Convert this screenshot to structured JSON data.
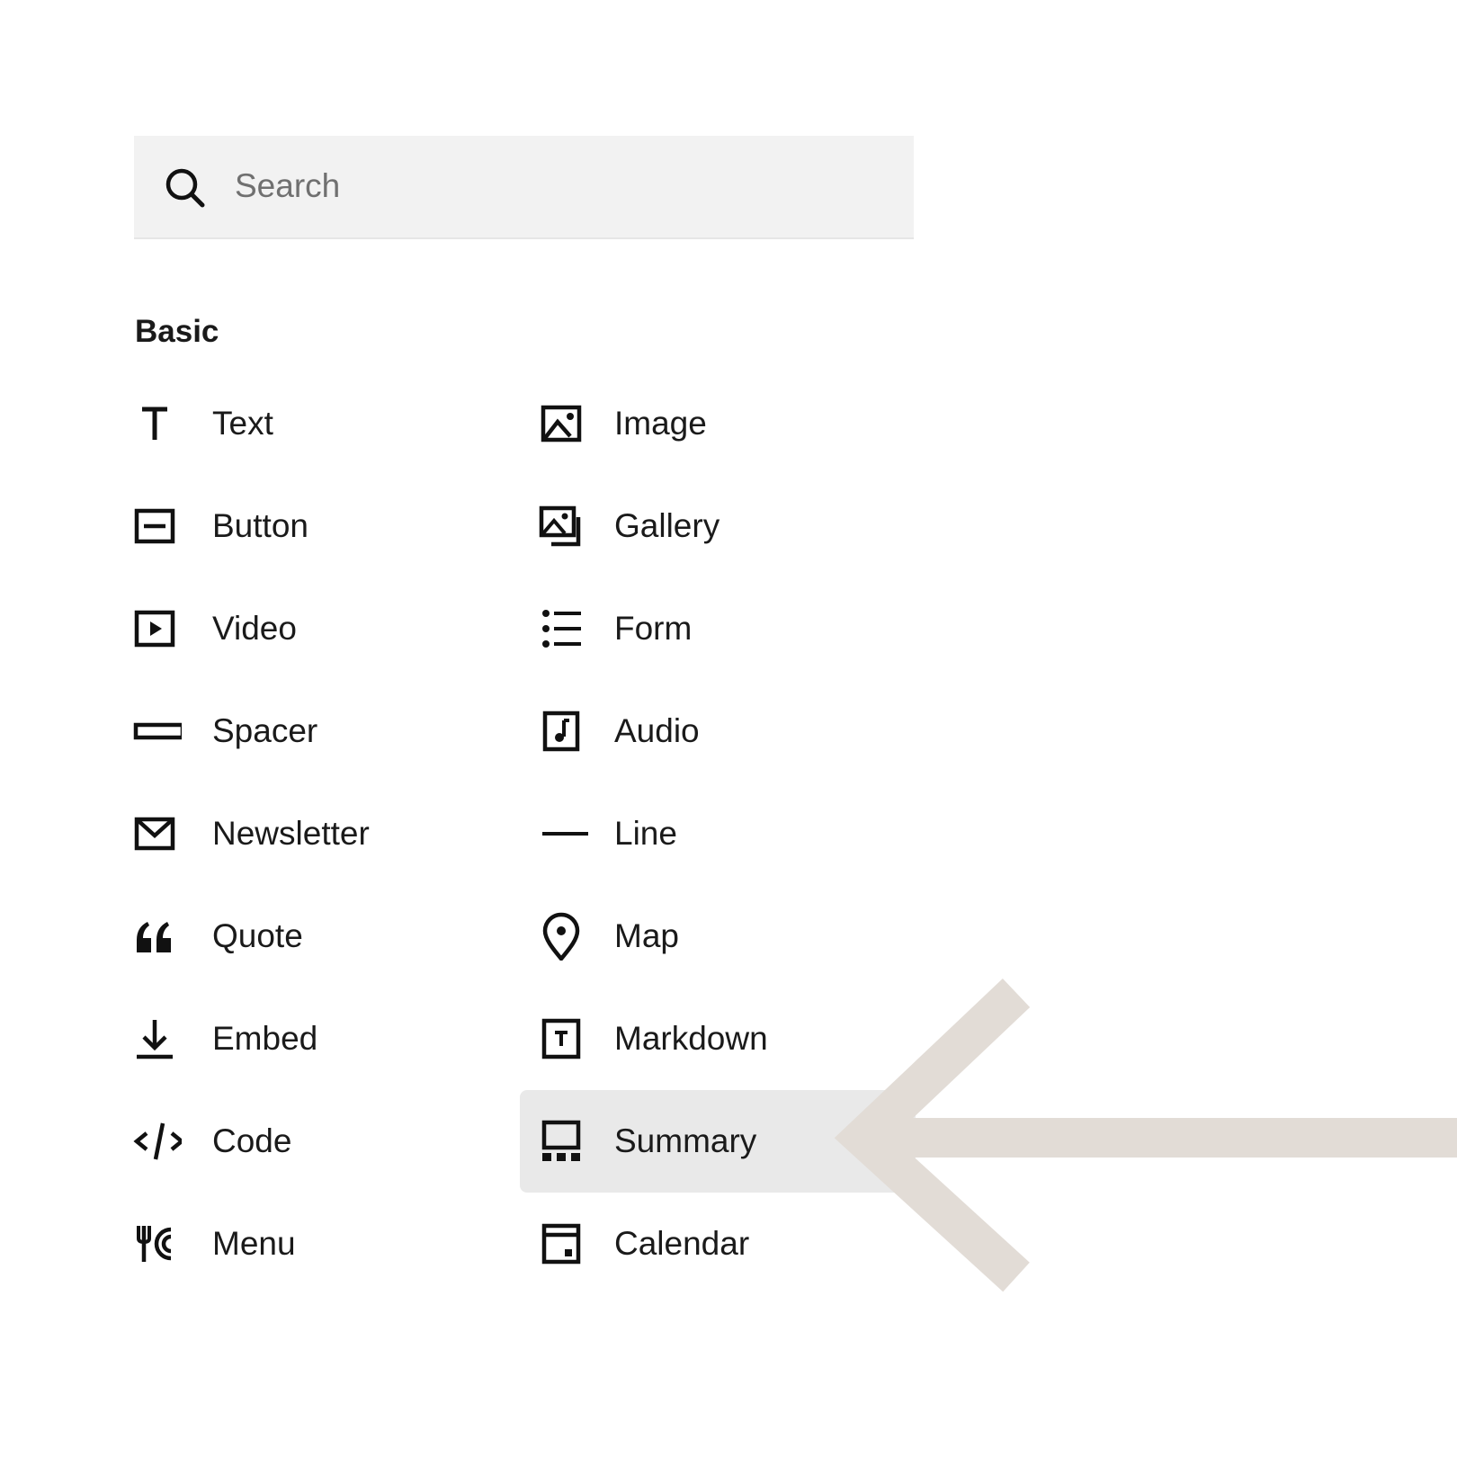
{
  "search": {
    "placeholder": "Search",
    "icon": "search-icon"
  },
  "section": {
    "title": "Basic"
  },
  "blocks": {
    "left": [
      {
        "label": "Text",
        "icon": "text-icon"
      },
      {
        "label": "Button",
        "icon": "button-icon"
      },
      {
        "label": "Video",
        "icon": "video-icon"
      },
      {
        "label": "Spacer",
        "icon": "spacer-icon"
      },
      {
        "label": "Newsletter",
        "icon": "envelope-icon"
      },
      {
        "label": "Quote",
        "icon": "quote-icon"
      },
      {
        "label": "Embed",
        "icon": "download-arrow-icon"
      },
      {
        "label": "Code",
        "icon": "code-icon"
      },
      {
        "label": "Menu",
        "icon": "fork-plate-icon"
      }
    ],
    "right": [
      {
        "label": "Image",
        "icon": "image-icon"
      },
      {
        "label": "Gallery",
        "icon": "gallery-icon"
      },
      {
        "label": "Form",
        "icon": "list-icon"
      },
      {
        "label": "Audio",
        "icon": "music-note-icon"
      },
      {
        "label": "Line",
        "icon": "line-icon"
      },
      {
        "label": "Map",
        "icon": "map-pin-icon"
      },
      {
        "label": "Markdown",
        "icon": "markdown-icon"
      },
      {
        "label": "Summary",
        "icon": "summary-icon",
        "selected": true
      },
      {
        "label": "Calendar",
        "icon": "calendar-icon"
      }
    ]
  },
  "colors": {
    "search_background": "#f2f2f2",
    "selected_background": "#e9e9e9",
    "arrow": "#e2dcd6",
    "text": "#1a1a1a",
    "placeholder": "#707070"
  }
}
